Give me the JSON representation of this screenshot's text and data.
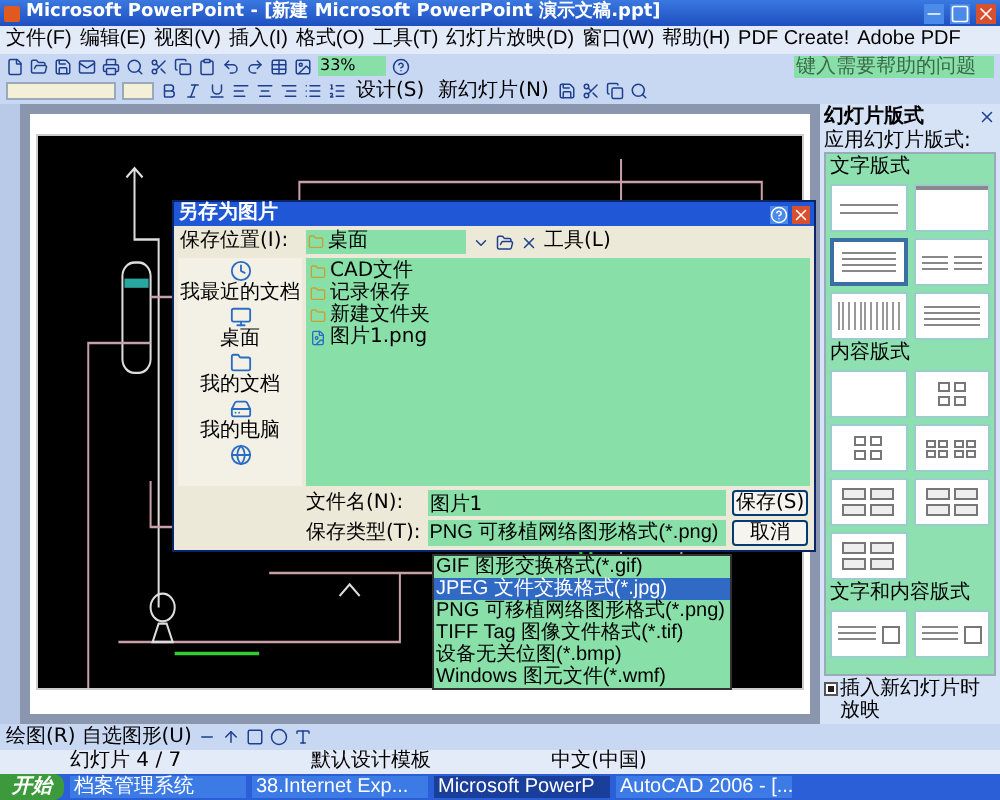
{
  "window": {
    "title": "Microsoft PowerPoint - [新建 Microsoft PowerPoint 演示文稿.ppt]"
  },
  "menu": [
    "文件(F)",
    "编辑(E)",
    "视图(V)",
    "插入(I)",
    "格式(O)",
    "工具(T)",
    "幻灯片放映(D)",
    "窗口(W)",
    "帮助(H)",
    "PDF Create!",
    "Adobe PDF"
  ],
  "help_box": {
    "placeholder": "键入需要帮助的问题"
  },
  "zoom": {
    "value": "33%"
  },
  "format_toolbar": {
    "design_button": "设计(S)",
    "new_slide_button": "新幻灯片(N)"
  },
  "dialog": {
    "title": "另存为图片",
    "location_label": "保存位置(I):",
    "location": "桌面",
    "tools": "工具(L)",
    "places": [
      {
        "label": "我最近的文档",
        "kind": "recent"
      },
      {
        "label": "桌面",
        "kind": "desktop"
      },
      {
        "label": "我的文档",
        "kind": "documents"
      },
      {
        "label": "我的电脑",
        "kind": "computer"
      },
      {
        "kind": "network"
      }
    ],
    "files": [
      {
        "name": "CAD文件",
        "kind": "folder"
      },
      {
        "name": "记录保存",
        "kind": "folder"
      },
      {
        "name": "新建文件夹",
        "kind": "folder"
      },
      {
        "name": "图片1.png",
        "kind": "image"
      }
    ],
    "filename_label": "文件名(N):",
    "filename": "图片1",
    "type_label": "保存类型(T):",
    "type": "PNG 可移植网络图形格式(*.png)",
    "save_button": "保存(S)",
    "cancel_button": "取消",
    "type_options": [
      {
        "label": "GIF 图形交换格式(*.gif)",
        "selected": false
      },
      {
        "label": "JPEG 文件交换格式(*.jpg)",
        "selected": true
      },
      {
        "label": "PNG 可移植网络图形格式(*.png)",
        "selected": false
      },
      {
        "label": "TIFF Tag 图像文件格式(*.tif)",
        "selected": false
      },
      {
        "label": "设备无关位图(*.bmp)",
        "selected": false
      },
      {
        "label": "Windows 图元文件(*.wmf)",
        "selected": false
      }
    ]
  },
  "task_pane": {
    "title": "幻灯片版式",
    "apply_label": "应用幻灯片版式:",
    "sections": [
      {
        "title": "文字版式",
        "layouts": [
          {
            "kind": "title",
            "selected": false
          },
          {
            "kind": "blank-title",
            "selected": false
          },
          {
            "kind": "text",
            "selected": true
          },
          {
            "kind": "two-text",
            "selected": false
          },
          {
            "kind": "columns",
            "selected": false
          },
          {
            "kind": "text",
            "selected": false
          }
        ]
      },
      {
        "title": "内容版式",
        "layouts": [
          {
            "kind": "blank",
            "selected": false
          },
          {
            "kind": "content",
            "selected": false
          },
          {
            "kind": "content",
            "selected": false
          },
          {
            "kind": "two-content",
            "selected": false
          },
          {
            "kind": "four-content",
            "selected": false
          },
          {
            "kind": "four-content",
            "selected": false
          },
          {
            "kind": "four-content",
            "selected": false
          }
        ]
      },
      {
        "title": "文字和内容版式",
        "layouts": [
          {
            "kind": "text-content",
            "selected": false
          },
          {
            "kind": "text-content",
            "selected": false
          }
        ]
      }
    ],
    "footer": {
      "label": "插入新幻灯片时放映",
      "checked": true
    }
  },
  "drawing_toolbar": {
    "draw": "绘图(R)",
    "autoshapes": "自选图形(U)"
  },
  "status_bar": [
    "幻灯片 4 / 7",
    "默认设计模板",
    "中文(中国)"
  ],
  "taskbar": {
    "start": "开始",
    "tasks": [
      {
        "label": "档案管理系统",
        "selected": false
      },
      {
        "label": "38.Internet Exp...",
        "selected": false
      },
      {
        "label": "Microsoft PowerP",
        "selected": true
      },
      {
        "label": "AutoCAD 2006 - [...",
        "selected": false
      }
    ]
  }
}
